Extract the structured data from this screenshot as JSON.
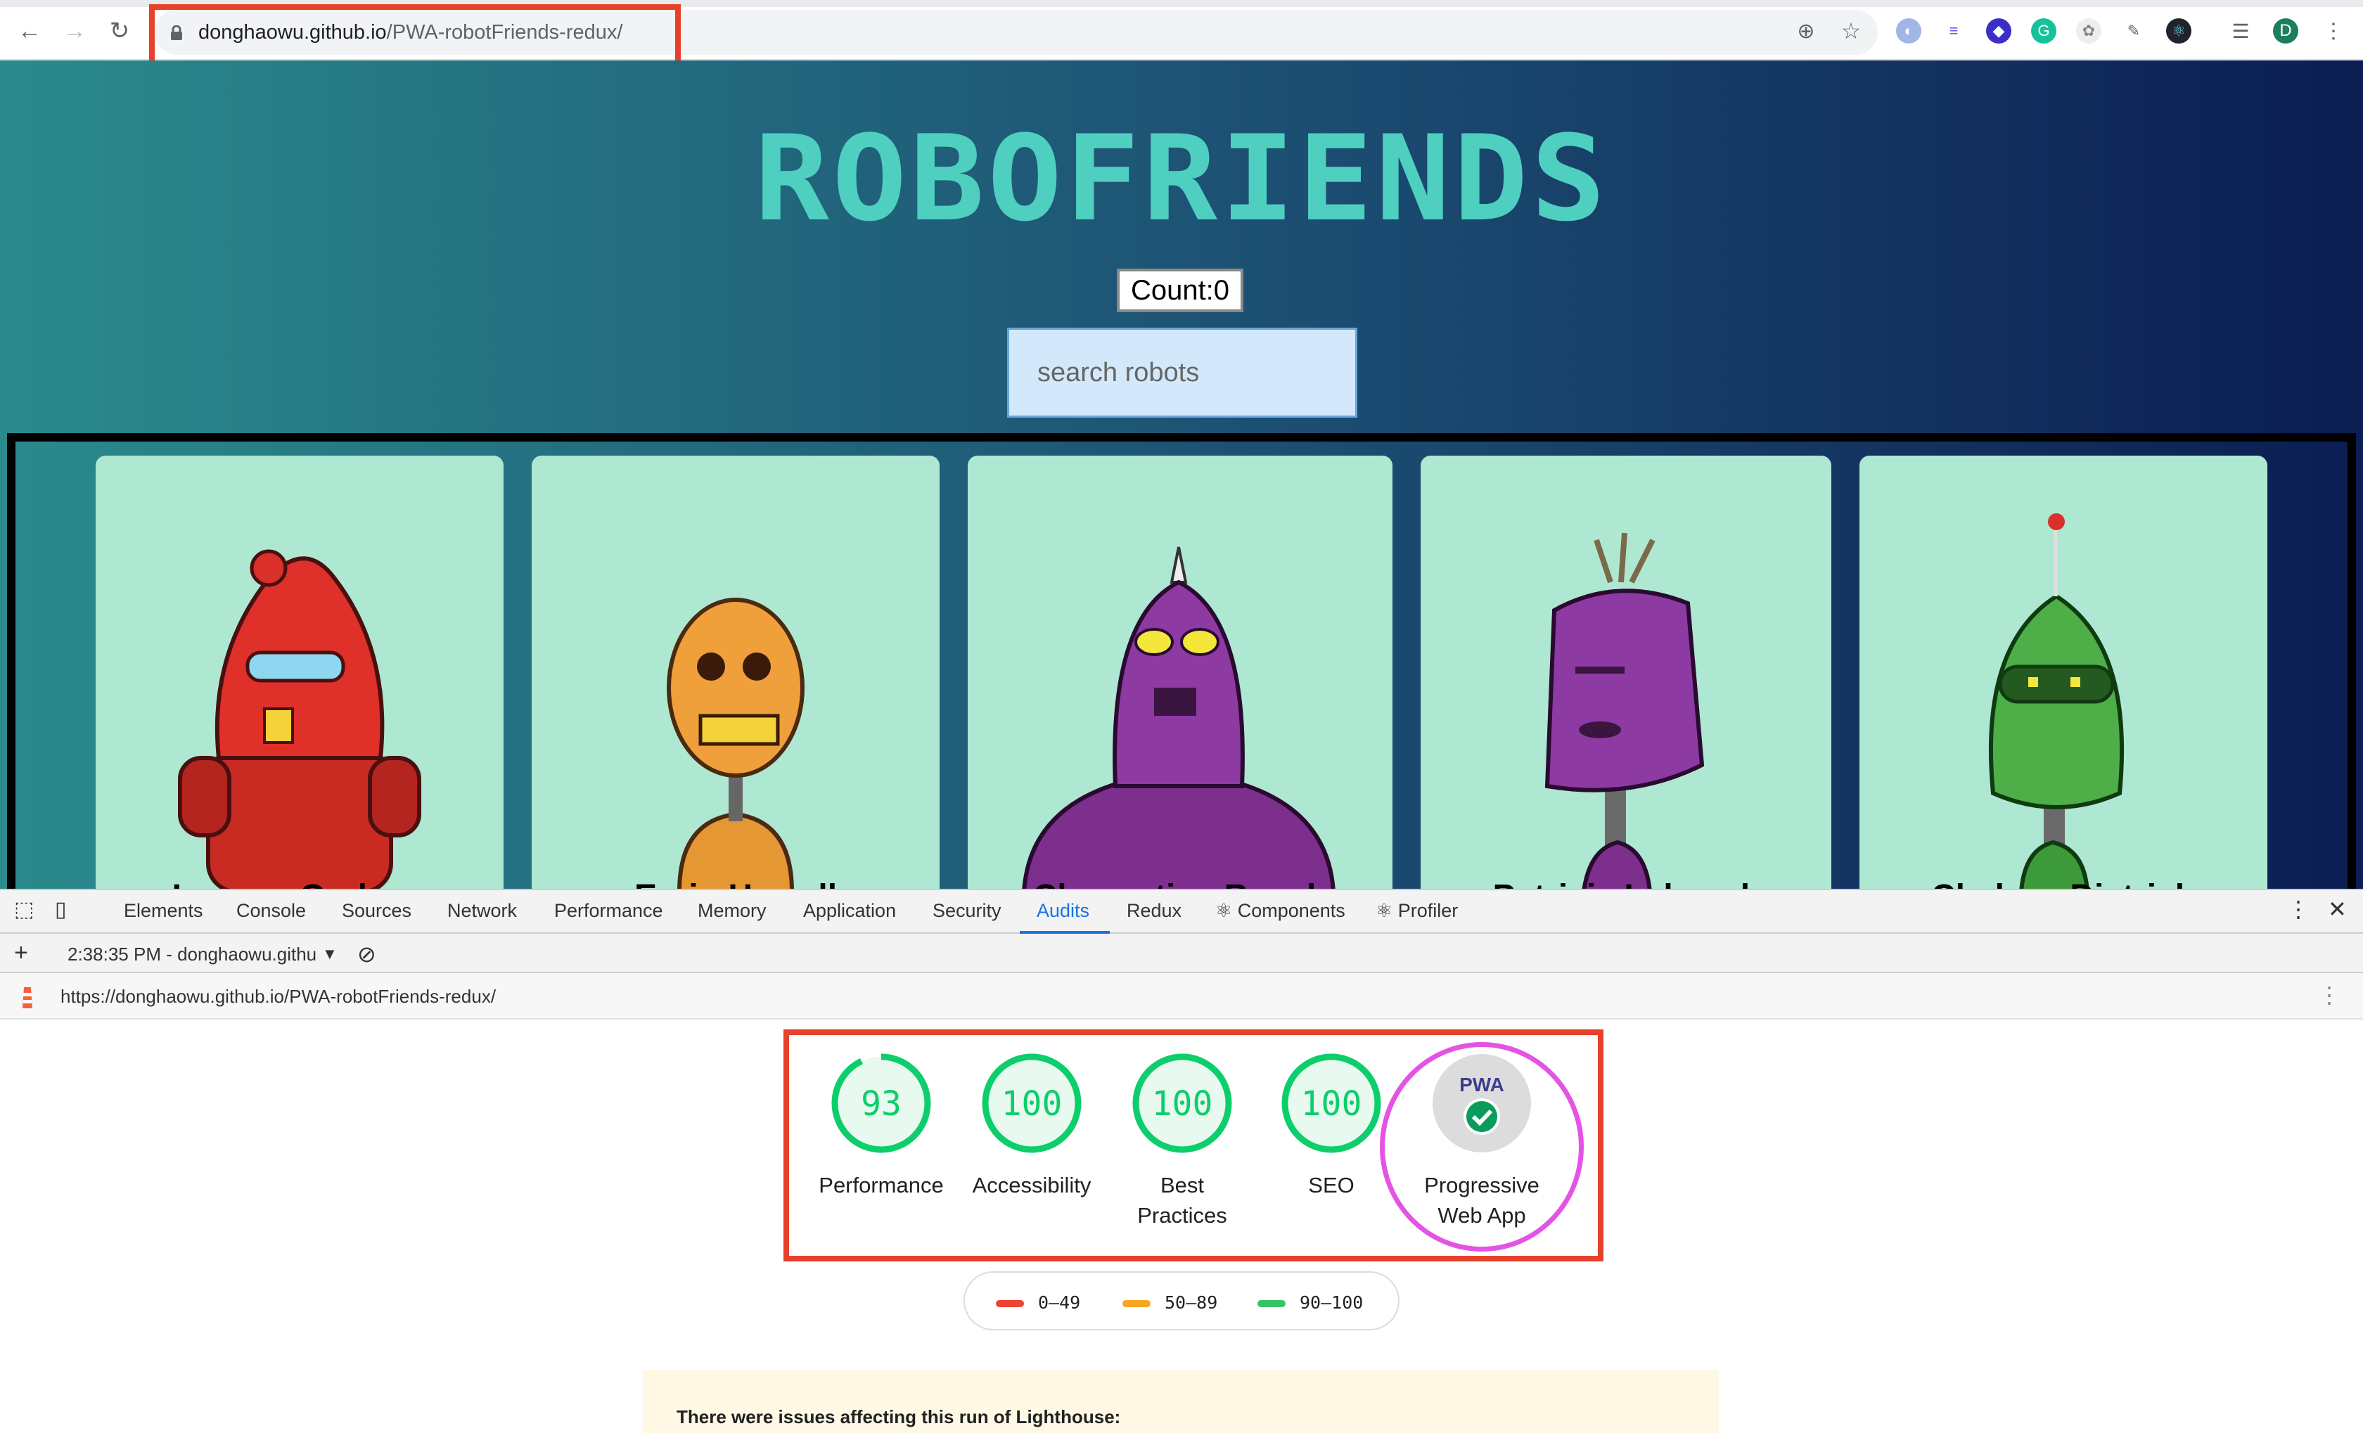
{
  "browser": {
    "url_host": "donghaowu.github.io",
    "url_path": "/PWA-robotFriends-redux/",
    "avatar_letter": "D"
  },
  "page": {
    "logo": "ROBOFRIENDS",
    "count_label": "Count:0",
    "search_placeholder": "search robots",
    "robot_names": [
      "Leanne Graham",
      "Ervin Howell",
      "Clementine Bauch",
      "Patricia Lebsack",
      "Chelsey Dietrich"
    ]
  },
  "devtools": {
    "tabs": [
      "Elements",
      "Console",
      "Sources",
      "Network",
      "Performance",
      "Memory",
      "Application",
      "Security",
      "Audits",
      "Redux",
      "⚛ Components",
      "⚛ Profiler"
    ],
    "active_tab": "Audits",
    "report_select": "2:38:35 PM - donghaowu.githu",
    "report_url": "https://donghaowu.github.io/PWA-robotFriends-redux/",
    "scores": [
      {
        "label": "Performance",
        "value": "93",
        "score": 93
      },
      {
        "label": "Accessibility",
        "value": "100",
        "score": 100
      },
      {
        "label": "Best Practices",
        "value": "100",
        "score": 100
      },
      {
        "label": "SEO",
        "value": "100",
        "score": 100
      }
    ],
    "pwa": {
      "badge": "PWA",
      "label": "Progressive Web App"
    },
    "legend": [
      {
        "range": "0–49",
        "color": "#eb4436"
      },
      {
        "range": "50–89",
        "color": "#f5a623"
      },
      {
        "range": "90–100",
        "color": "#34c461"
      }
    ],
    "warning": "There were issues affecting this run of Lighthouse:"
  },
  "colors": {
    "score_good": "#0cce6b",
    "highlight_red": "#e8402a",
    "highlight_magenta": "#e454e4"
  }
}
